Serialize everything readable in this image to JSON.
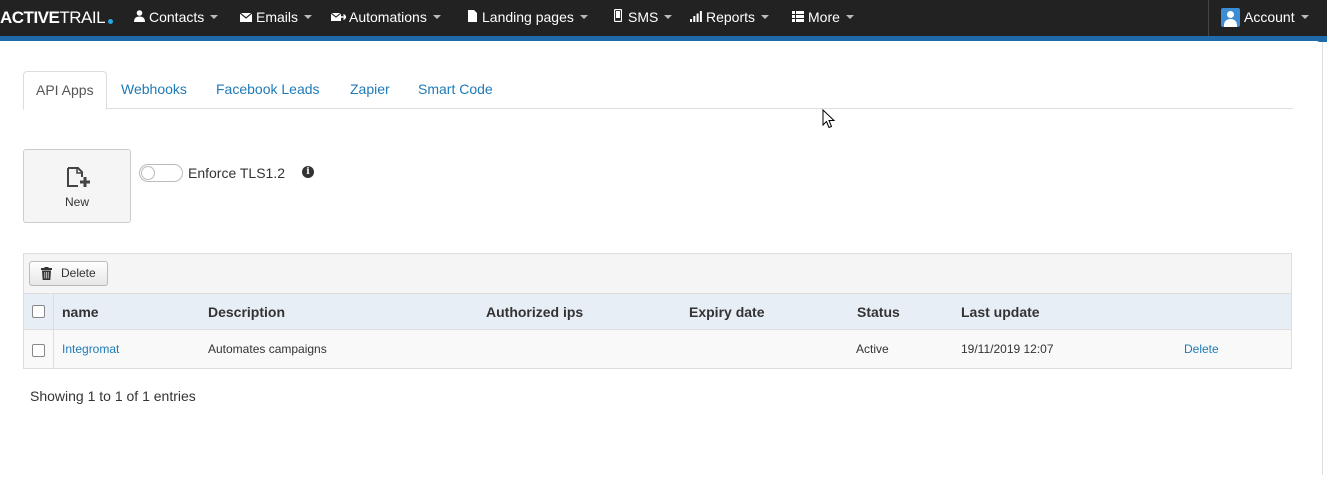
{
  "brand": {
    "logo_bold": "ACTIVE",
    "logo_light": "TRAIL"
  },
  "nav": {
    "items": [
      {
        "label": "Contacts",
        "icon": "user-icon"
      },
      {
        "label": "Emails",
        "icon": "envelope-icon"
      },
      {
        "label": "Automations",
        "icon": "automation-icon"
      },
      {
        "label": "Landing pages",
        "icon": "file-icon"
      },
      {
        "label": "SMS",
        "icon": "mobile-icon"
      },
      {
        "label": "Reports",
        "icon": "bar-chart-icon"
      },
      {
        "label": "More",
        "icon": "list-icon"
      }
    ],
    "account_label": "Account"
  },
  "tabs": [
    {
      "label": "API Apps",
      "active": true
    },
    {
      "label": "Webhooks",
      "active": false
    },
    {
      "label": "Facebook Leads",
      "active": false
    },
    {
      "label": "Zapier",
      "active": false
    },
    {
      "label": "Smart Code",
      "active": false
    }
  ],
  "actions": {
    "new_label": "New",
    "tls_label": "Enforce TLS1.2",
    "tls_enabled": false,
    "delete_label": "Delete"
  },
  "table": {
    "columns": [
      "name",
      "Description",
      "Authorized ips",
      "Expiry date",
      "Status",
      "Last update"
    ],
    "rows": [
      {
        "name": "Integromat",
        "description": "Automates campaigns",
        "authorized_ips": "",
        "expiry_date": "",
        "status": "Active",
        "last_update": "19/11/2019 12:07",
        "action": "Delete"
      }
    ],
    "footer": "Showing 1 to 1 of 1 entries"
  },
  "colors": {
    "nav_bg": "#222222",
    "accent_blue": "#1f7ab8",
    "strip_blue": "#1f6aa8",
    "header_bg": "#e8eef5"
  }
}
